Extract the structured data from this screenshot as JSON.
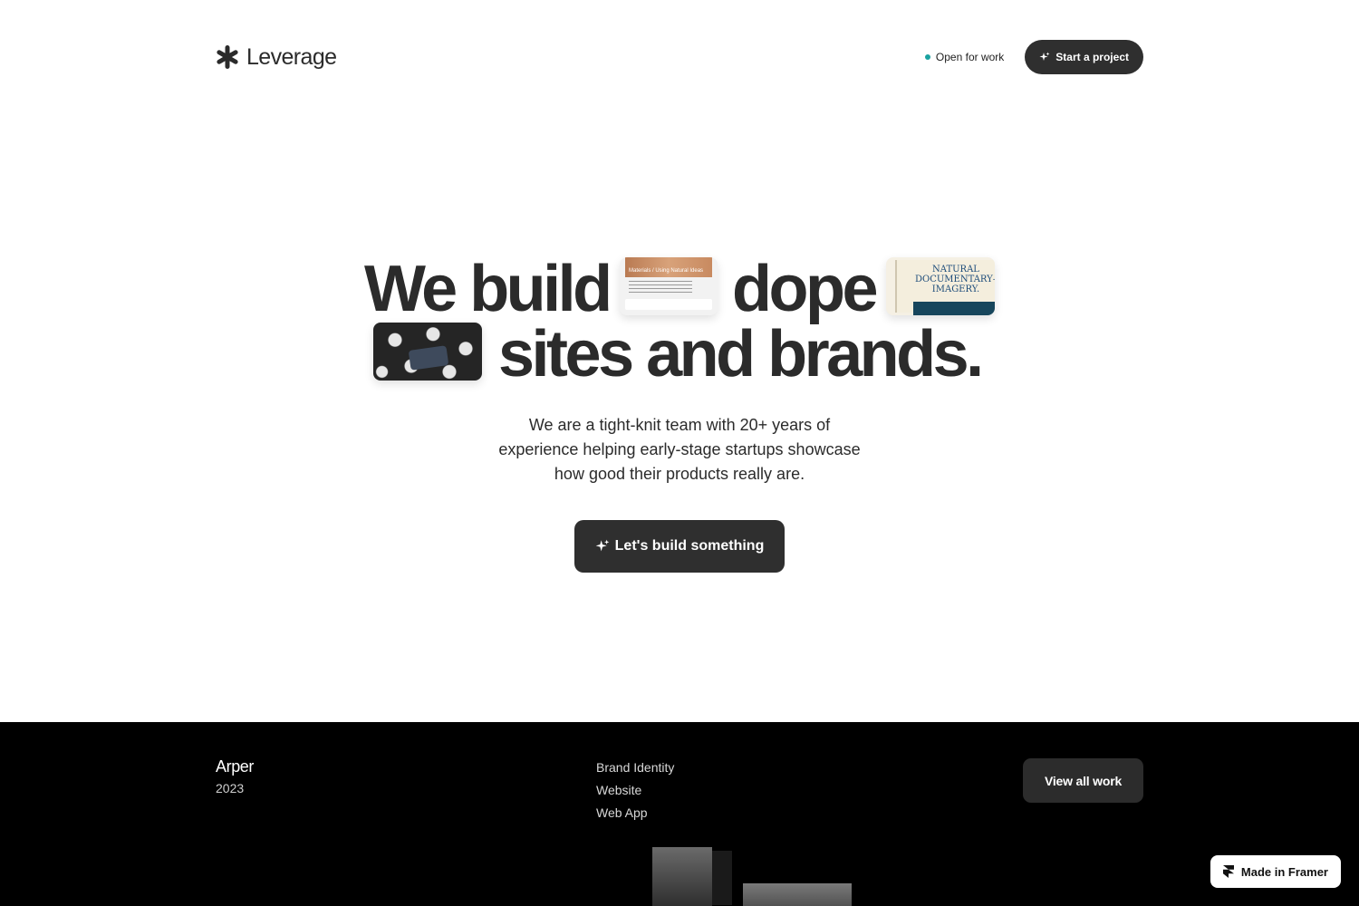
{
  "header": {
    "brand_name": "Leverage",
    "status_label": "Open for work",
    "start_project_label": "Start a project"
  },
  "hero": {
    "line1_word1": "We build",
    "line1_word2": "dope",
    "line2_text": "sites and brands.",
    "thumb_a_caption": "Materials / Using Natural Ideas",
    "thumb_b_text_1": "NATURAL",
    "thumb_b_text_2": "DOCUMENTARY—ST",
    "thumb_b_text_3": "IMAGERY.",
    "subtext_line1": "We are a tight-knit team with 20+ years of",
    "subtext_line2": "experience helping early-stage startups showcase",
    "subtext_line3": "how good their products really are.",
    "cta_label": "Let's build something"
  },
  "project": {
    "name": "Arper",
    "year": "2023",
    "services": [
      "Brand Identity",
      "Website",
      "Web App"
    ],
    "view_all_label": "View all work"
  },
  "badge": {
    "label": "Made in Framer"
  },
  "colors": {
    "status_dot": "#1aa2a0",
    "button_dark": "#2f2f2f",
    "section_dark": "#000000"
  },
  "icons": {
    "brand": "asterisk-logo-icon",
    "sparkle": "sparkle-icon",
    "framer": "framer-logo-icon"
  }
}
